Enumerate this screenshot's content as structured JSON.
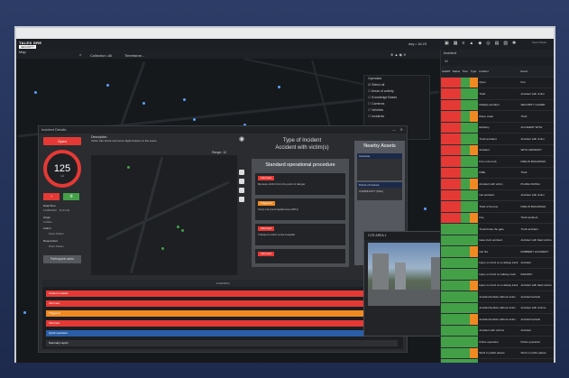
{
  "app": {
    "logo": "TALES GRE",
    "logo_sub": "SECURITY",
    "clock": "day • 16:23",
    "user": "Team Shoot"
  },
  "map": {
    "title": "Map",
    "collection": "Collection: All",
    "timeframe": "Timeframe..."
  },
  "layers": {
    "title": "Operation",
    "items": [
      "Select all",
      "Areas of activity",
      "Knowledge Bases",
      "Cameras",
      "Vehicles",
      "Incidents"
    ]
  },
  "incident": {
    "window_title": "Incident Details",
    "status_button": "Open",
    "count": "125",
    "count_unit": "m2",
    "date_label": "Date/Time",
    "date_value": "11/28/2022 · 15:21:00",
    "origin_label": "Origin",
    "origin_value": "Civilian",
    "author_label": "Author",
    "author_value": "Peter Parker",
    "responders_label": "Responders",
    "responders_value": "Peter Parker",
    "participant_button": "Participant users",
    "description_label": "Description",
    "description_text": "Victim has shock and some slight bruises on the scene",
    "range_label": "Range: 10",
    "type_title_1": "Type of Incident",
    "type_title_2": "Accident with victim(s)",
    "sop_title": "Standard operational procedure",
    "sop_items": [
      {
        "tag": "Informed",
        "text": "Remove victim from the point of danger"
      },
      {
        "tag": "Triggered",
        "text": "Carry out pre-hospital care (APH)"
      },
      {
        "tag": "Informed",
        "text": "Transport victim to the hospital"
      },
      {
        "tag": "Informed",
        "text": ""
      }
    ],
    "nearby_title": "Nearby Assets",
    "nearby_cameras": "Cameras",
    "nearby_nodes": "Points of Interest",
    "nearby_node_item": "COMMUNITY (50m)",
    "timeline_date": "12/28/2022",
    "timeline_bars": [
      "Incident created",
      "Informed",
      "Triggered",
      "Informed",
      "Quick operation",
      "Summary report"
    ]
  },
  "camera": {
    "title": "CCR AREA 1"
  },
  "right": {
    "title": "Incident",
    "filter": "All",
    "columns": [
      "ALERT",
      "Status",
      "Time",
      "Type",
      "Incident",
      "Event"
    ],
    "rows": [
      {
        "alert": "red",
        "a": "Open",
        "b": "Fire",
        "c": "Fire"
      },
      {
        "alert": "red",
        "a": "Theft",
        "b": "Suspect item",
        "c": "Accident with victim"
      },
      {
        "alert": "red",
        "a": "Multiple accident",
        "b": "Accident",
        "c": "SECURITY GUARD"
      },
      {
        "alert": "red",
        "a": "Plane crash",
        "b": "Hazard",
        "c": "Theft"
      },
      {
        "alert": "red",
        "a": "Robbery",
        "b": "Robbery",
        "c": "ACCIDENT WITH"
      },
      {
        "alert": "red",
        "a": "Truck accident",
        "b": "Hazard",
        "c": "Accident with victim"
      },
      {
        "alert": "red",
        "a": "Accident",
        "b": "Accident",
        "c": "WITH AIRCRAFT"
      },
      {
        "alert": "red",
        "a": "Fire in the hub",
        "b": "Fire in the hub",
        "c": "FIRE IN BUILDINGS"
      },
      {
        "alert": "red",
        "a": "FIRE",
        "b": "FIRE",
        "c": "Theft"
      },
      {
        "alert": "red",
        "a": "Accident with victim",
        "b": "Accident",
        "c": "PLANE CRASH"
      },
      {
        "alert": "red",
        "a": "Car accident",
        "b": "Car accident",
        "c": "Accident with victim"
      },
      {
        "alert": "red",
        "a": "Theft of the bus",
        "b": "Theft",
        "c": "FIRE IN BUILDINGS"
      },
      {
        "alert": "red",
        "a": "Fire",
        "b": "Fire",
        "c": "Theft accident"
      },
      {
        "alert": "green",
        "a": "Truck broke the gate",
        "b": "Truck",
        "c": "Truck accident"
      },
      {
        "alert": "green",
        "a": "Gate truck accident",
        "b": "Accident",
        "c": "Accident with fatal victims"
      },
      {
        "alert": "green",
        "a": "Car fire",
        "b": "Fire",
        "c": "ROBBERY ACCIDENT"
      },
      {
        "alert": "green",
        "a": "Injury on truck on a railway track",
        "b": "Accident",
        "c": "Accident"
      },
      {
        "alert": "green",
        "a": "Injury on truck on railway track",
        "b": "Accident",
        "c": "RAILWAY"
      },
      {
        "alert": "green",
        "a": "Injury on truck on a railway track",
        "b": "Accident",
        "c": "Accident with fatal victims"
      },
      {
        "alert": "green",
        "a": "Accident/vehicle without victim",
        "b": "Accident",
        "c": "Accident/vehicle"
      },
      {
        "alert": "green",
        "a": "Accident/vehicle without victim",
        "b": "Accident",
        "c": "Accident with victims"
      },
      {
        "alert": "green",
        "a": "Accident/vehicle without victim",
        "b": "Accident",
        "c": "Accident/vehicle"
      },
      {
        "alert": "green",
        "a": "Accident with victims",
        "b": "Accident",
        "c": "Accident"
      },
      {
        "alert": "green",
        "a": "Police operation",
        "b": "Police",
        "c": "Police operation"
      },
      {
        "alert": "green",
        "a": "Work in public places",
        "b": "Work",
        "c": "Work in public places"
      },
      {
        "alert": "green",
        "a": "Accident with victim(s)",
        "b": "Accident",
        "c": "Accident with victim(s)"
      },
      {
        "alert": "green",
        "a": "Robbery",
        "b": "Robbery",
        "c": "Robbery"
      }
    ]
  },
  "colors": {
    "red": "#e53935",
    "orange": "#ef8a22",
    "green": "#43a047",
    "blue": "#2b5ea8"
  }
}
